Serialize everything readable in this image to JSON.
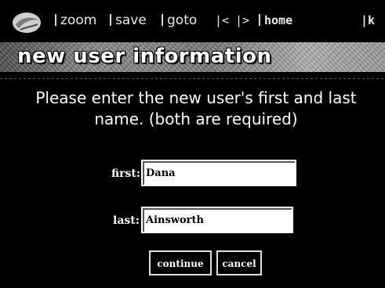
{
  "toolbar": {
    "logo_icon": "globe-icon",
    "zoom": "zoom",
    "save": "save",
    "goto": "goto",
    "prev": "|<",
    "next": "|>",
    "home": "home",
    "first": "|k"
  },
  "page": {
    "title": "new user information",
    "prompt_line1": "Please enter the new user's first and last",
    "prompt_line2": "name. (both are required)"
  },
  "form": {
    "first_label": "first:",
    "first_value": "Dana",
    "last_label": "last:",
    "last_value": "Ainsworth",
    "continue_label": "continue",
    "cancel_label": "cancel"
  },
  "colors": {
    "background": "#000000",
    "text": "#ffffff"
  }
}
